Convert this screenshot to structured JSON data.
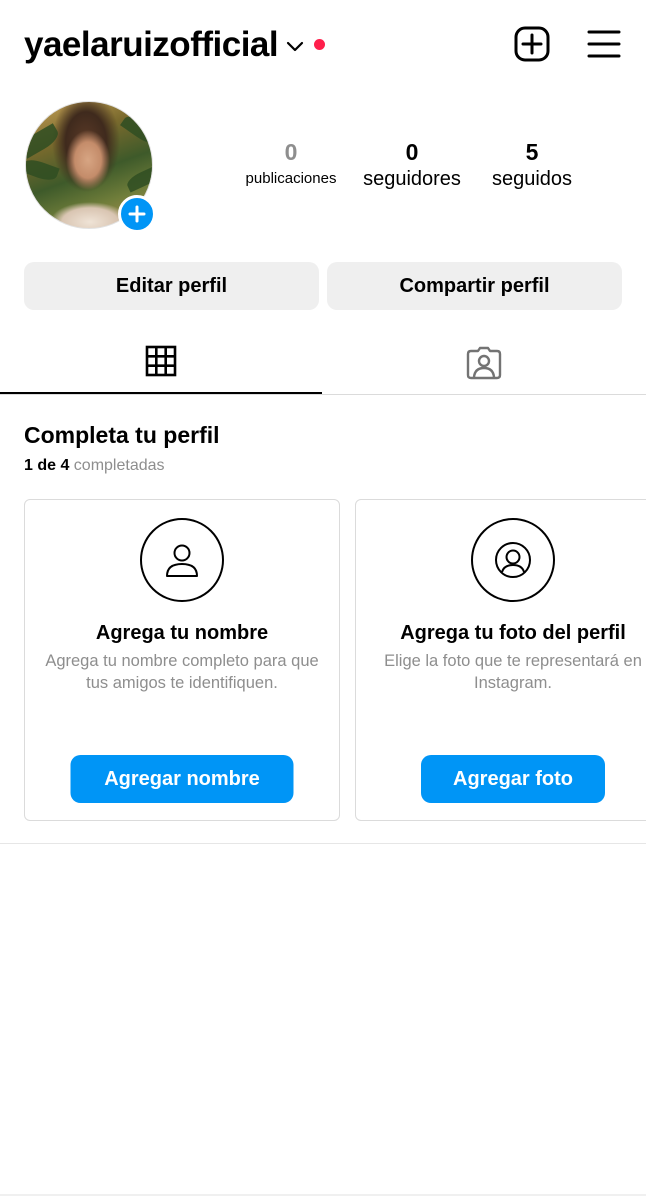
{
  "header": {
    "username": "yaelaruizofficial",
    "notification_color": "#ff1f4b",
    "icons": [
      "chevron-down-icon",
      "new-post-icon",
      "menu-icon"
    ]
  },
  "profile": {
    "posts": {
      "count": "0",
      "label": "publicaciones"
    },
    "followers": {
      "count": "0",
      "label": "seguidores"
    },
    "following": {
      "count": "5",
      "label": "seguidos"
    }
  },
  "actions": {
    "edit": "Editar perfil",
    "share": "Compartir perfil"
  },
  "tabs": [
    {
      "icon": "grid-icon",
      "active": true
    },
    {
      "icon": "tagged-person-icon",
      "active": false
    }
  ],
  "complete_profile": {
    "title": "Completa tu perfil",
    "progress_bold": "1 de 4",
    "progress_rest": " completadas",
    "cards": [
      {
        "icon": "person-icon",
        "title": "Agrega tu nombre",
        "description": "Agrega tu nombre completo para que tus amigos te identifiquen.",
        "button": "Agregar nombre"
      },
      {
        "icon": "profile-photo-icon",
        "title": "Agrega tu foto del perfil",
        "description": "Elige la foto que te representará en Instagram.",
        "button": "Agregar foto"
      }
    ]
  },
  "colors": {
    "accent": "#0095f6",
    "secondary_text": "#8e8e8e",
    "button_gray": "#efefef"
  }
}
